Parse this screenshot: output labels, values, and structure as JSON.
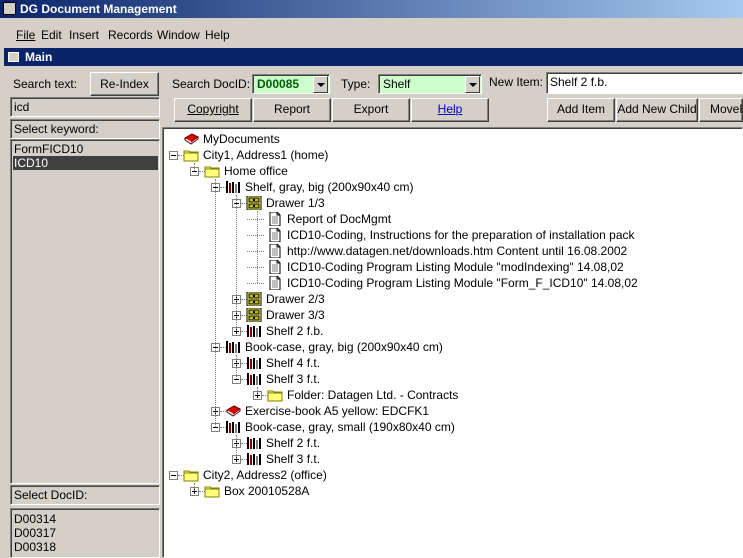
{
  "app": {
    "title": "DG Document Management"
  },
  "menu": [
    "File",
    "Edit",
    "Insert",
    "Records",
    "Window",
    "Help"
  ],
  "window": {
    "title": "Main"
  },
  "search": {
    "label": "Search text:",
    "reindex_label": "Re-Index",
    "value": "icd"
  },
  "keywords": {
    "label": "Select keyword:",
    "items": [
      "FormFICD10",
      "ICD10"
    ],
    "selected_index": 1
  },
  "docid": {
    "label": "Search DocID:",
    "value": "D00085"
  },
  "type": {
    "label": "Type:",
    "value": "Shelf"
  },
  "newitem": {
    "label": "New Item:",
    "value": "Shelf 2 f.b."
  },
  "buttons": {
    "copyright": "Copyright",
    "report": "Report",
    "export": "Export",
    "help": "Help",
    "add_item": "Add Item",
    "add_child": "Add New Child",
    "move": "MoveF"
  },
  "select_docid": {
    "label": "Select DocID:",
    "items": [
      "D00314",
      "D00317",
      "D00318"
    ]
  },
  "tree": [
    {
      "level": 0,
      "icon": "book",
      "toggle": "none",
      "label": "MyDocuments"
    },
    {
      "level": 0,
      "icon": "folder",
      "toggle": "open",
      "label": "City1, Address1 (home)"
    },
    {
      "level": 1,
      "icon": "folder",
      "toggle": "open",
      "label": "Home office"
    },
    {
      "level": 2,
      "icon": "shelf",
      "toggle": "open",
      "label": "Shelf, gray, big (200x90x40 cm)"
    },
    {
      "level": 3,
      "icon": "drawer",
      "toggle": "open",
      "label": "Drawer 1/3"
    },
    {
      "level": 4,
      "icon": "doc",
      "toggle": "none",
      "label": "Report of DocMgmt"
    },
    {
      "level": 4,
      "icon": "doc",
      "toggle": "none",
      "label": "ICD10-Coding, Instructions for the preparation of installation pack"
    },
    {
      "level": 4,
      "icon": "doc",
      "toggle": "none",
      "label": "http://www.datagen.net/downloads.htm Content until 16.08.2002"
    },
    {
      "level": 4,
      "icon": "doc",
      "toggle": "none",
      "label": "ICD10-Coding Program Listing Module \"modIndexing\" 14.08,02"
    },
    {
      "level": 4,
      "icon": "doc",
      "toggle": "none",
      "label": "ICD10-Coding Program Listing Module \"Form_F_ICD10\" 14.08,02"
    },
    {
      "level": 3,
      "icon": "drawer",
      "toggle": "closed",
      "label": "Drawer 2/3"
    },
    {
      "level": 3,
      "icon": "drawer",
      "toggle": "closed",
      "label": "Drawer 3/3"
    },
    {
      "level": 3,
      "icon": "shelf",
      "toggle": "closed",
      "label": "Shelf 2 f.b."
    },
    {
      "level": 2,
      "icon": "shelf",
      "toggle": "open",
      "label": "Book-case, gray, big (200x90x40 cm)"
    },
    {
      "level": 3,
      "icon": "shelf",
      "toggle": "closed",
      "label": "Shelf 4 f.t."
    },
    {
      "level": 3,
      "icon": "shelf",
      "toggle": "open",
      "label": "Shelf 3 f.t."
    },
    {
      "level": 4,
      "icon": "folder",
      "toggle": "closed",
      "label": "Folder: Datagen Ltd. - Contracts"
    },
    {
      "level": 2,
      "icon": "book",
      "toggle": "closed",
      "label": "Exercise-book A5 yellow: EDCFK1"
    },
    {
      "level": 2,
      "icon": "shelf",
      "toggle": "open",
      "label": "Book-case, gray, small (190x80x40 cm)"
    },
    {
      "level": 3,
      "icon": "shelf",
      "toggle": "closed",
      "label": "Shelf 2 f.t."
    },
    {
      "level": 3,
      "icon": "shelf",
      "toggle": "closed",
      "label": "Shelf 3 f.t."
    },
    {
      "level": 0,
      "icon": "folder",
      "toggle": "open",
      "label": "City2, Address2 (office)"
    },
    {
      "level": 1,
      "icon": "folder",
      "toggle": "closed",
      "label": "Box 20010528A"
    }
  ]
}
